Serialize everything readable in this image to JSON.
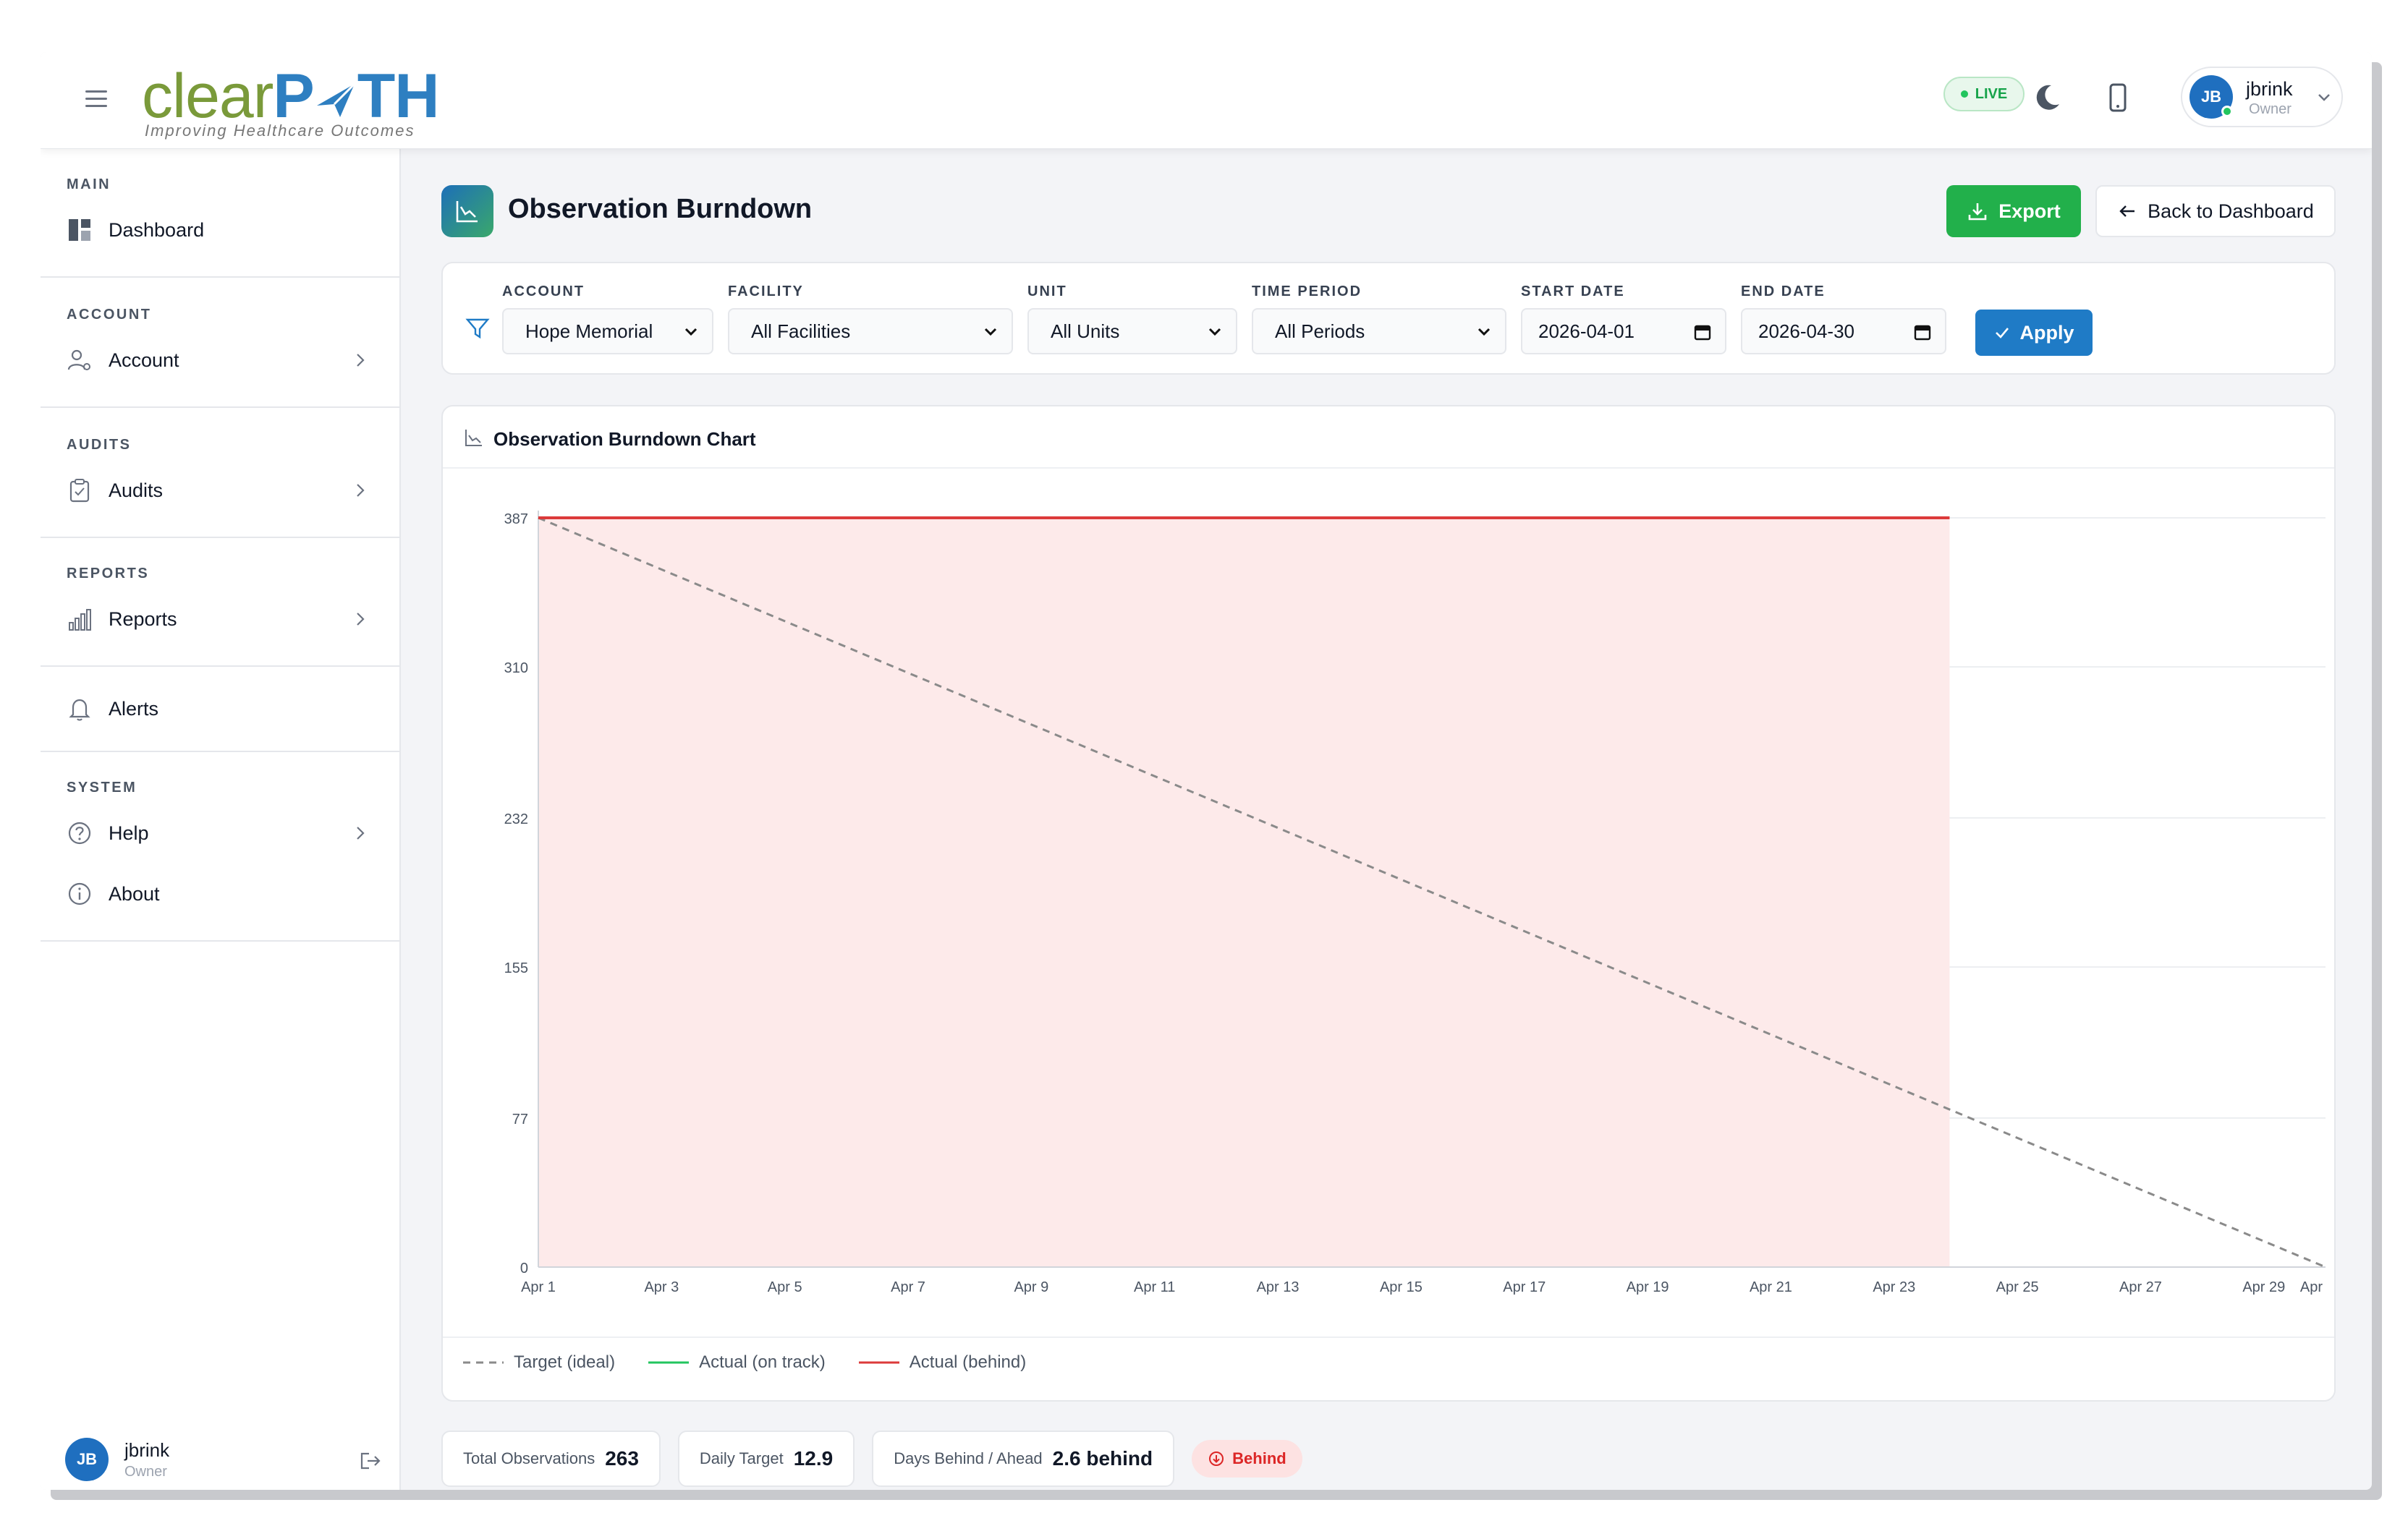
{
  "header": {
    "logo_part1": "clear",
    "logo_part2": "P",
    "logo_part3": "TH",
    "logo_tagline": "Improving Healthcare Outcomes",
    "live_label": "LIVE",
    "user_initials": "JB",
    "user_name": "jbrink",
    "user_role": "Owner"
  },
  "sidebar": {
    "sections": [
      {
        "title": "MAIN",
        "items": [
          {
            "label": "Dashboard",
            "icon": "dashboard-icon",
            "has_arrow": false
          }
        ]
      },
      {
        "title": "ACCOUNT",
        "items": [
          {
            "label": "Account",
            "icon": "user-gear-icon",
            "has_arrow": true
          }
        ]
      },
      {
        "title": "AUDITS",
        "items": [
          {
            "label": "Audits",
            "icon": "clipboard-icon",
            "has_arrow": true
          }
        ]
      },
      {
        "title": "REPORTS",
        "items": [
          {
            "label": "Reports",
            "icon": "bar-chart-icon",
            "has_arrow": true
          }
        ]
      },
      {
        "title": "",
        "items": [
          {
            "label": "Alerts",
            "icon": "bell-icon",
            "has_arrow": false
          }
        ]
      },
      {
        "title": "SYSTEM",
        "items": [
          {
            "label": "Help",
            "icon": "help-circle-icon",
            "has_arrow": true
          },
          {
            "label": "About",
            "icon": "info-circle-icon",
            "has_arrow": false
          }
        ]
      }
    ],
    "user": {
      "initials": "JB",
      "name": "jbrink",
      "role": "Owner"
    }
  },
  "page": {
    "title": "Observation Burndown",
    "export_label": "Export",
    "back_label": "Back to Dashboard"
  },
  "filters": {
    "account": {
      "label": "ACCOUNT",
      "value": "Hope Memorial"
    },
    "facility": {
      "label": "FACILITY",
      "value": "All Facilities"
    },
    "unit": {
      "label": "UNIT",
      "value": "All Units"
    },
    "time_period": {
      "label": "TIME PERIOD",
      "value": "All Periods"
    },
    "start_date": {
      "label": "START DATE",
      "value": "2026-04-01"
    },
    "end_date": {
      "label": "END DATE",
      "value": "2026-04-30"
    },
    "apply_label": "Apply"
  },
  "chart": {
    "title": "Observation Burndown Chart"
  },
  "chart_data": {
    "type": "line",
    "title": "Observation Burndown Chart",
    "x_ticks": [
      "Apr 1",
      "Apr 3",
      "Apr 5",
      "Apr 7",
      "Apr 9",
      "Apr 11",
      "Apr 13",
      "Apr 15",
      "Apr 17",
      "Apr 19",
      "Apr 21",
      "Apr 23",
      "Apr 25",
      "Apr 27",
      "Apr 29",
      "Apr"
    ],
    "y_ticks": [
      0,
      77,
      155,
      232,
      310,
      387
    ],
    "ylim": [
      0,
      387
    ],
    "xlim_days": [
      0,
      29
    ],
    "grid": true,
    "legend_position": "bottom-left",
    "series": [
      {
        "name": "Target (ideal)",
        "style": "dashed",
        "color": "#8a8a8a",
        "points": [
          [
            0,
            387
          ],
          [
            29,
            0
          ]
        ]
      },
      {
        "name": "Actual (on track)",
        "style": "solid",
        "color": "#22c55e",
        "points": []
      },
      {
        "name": "Actual (behind)",
        "style": "solid",
        "color": "#dc3a3a",
        "fill": "#fdeaea",
        "points": [
          [
            0,
            387
          ],
          [
            22.9,
            387
          ]
        ]
      }
    ]
  },
  "stats": {
    "total_label": "Total Observations",
    "total_value": "263",
    "daily_label": "Daily Target",
    "daily_value": "12.9",
    "days_label": "Days Behind / Ahead",
    "days_value": "2.6 behind",
    "status_badge": "Behind"
  },
  "colors": {
    "brand_green": "#7a9a3a",
    "brand_blue": "#2e7fc1",
    "export_green": "#22b04b",
    "apply_blue": "#1f7bc6",
    "behind_red": "#dc3a3a"
  }
}
